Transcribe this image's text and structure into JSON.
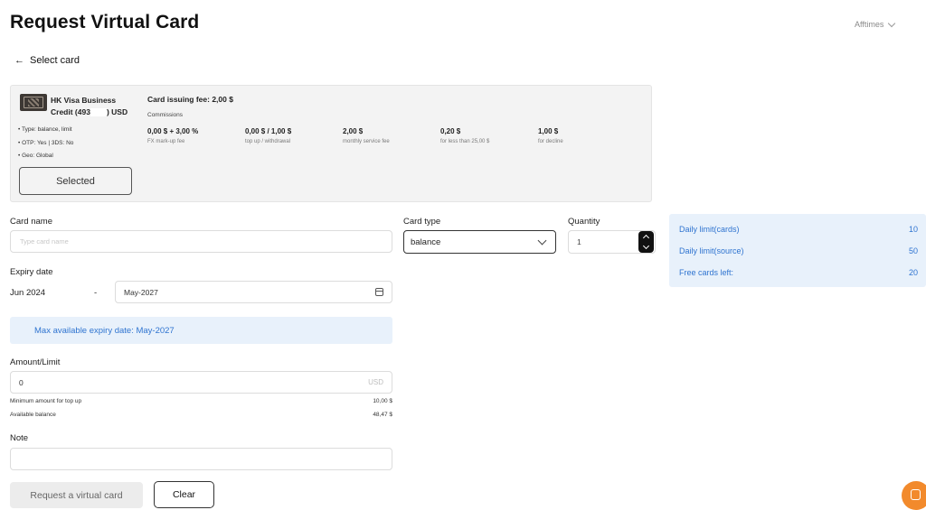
{
  "header": {
    "title": "Request Virtual Card",
    "user_name": "Afftimes",
    "back_label": "Select card",
    "back_arrow": "←"
  },
  "card": {
    "name_line1": "HK Visa Business",
    "name_line2_prefix": "Credit (493",
    "name_line2_suffix": ") USD",
    "specs": [
      "• Type: balance, limit",
      "• OTP: Yes | 3DS: No",
      "• Geo: Global"
    ],
    "issuing_fee": "Card issuing fee: 2,00 $",
    "commissions_label": "Commissions",
    "commissions": [
      {
        "value": "0,00 $ + 3,00 %",
        "label": "FX mark-up fee"
      },
      {
        "value": "0,00 $ / 1,00 $",
        "label": "top up / withdrawal"
      },
      {
        "value": "2,00 $",
        "label": "monthly service fee"
      },
      {
        "value": "0,20 $",
        "label": "for less than 25,00 $"
      },
      {
        "value": "1,00 $",
        "label": "for decline"
      }
    ],
    "selected_label": "Selected"
  },
  "form": {
    "card_name_label": "Card name",
    "card_name_placeholder": "Type card name",
    "card_type_label": "Card type",
    "card_type_value": "balance",
    "quantity_label": "Quantity",
    "quantity_value": "1",
    "expiry_label": "Expiry date",
    "expiry_from": "Jun 2024",
    "expiry_dash": "-",
    "expiry_to": "May-2027",
    "max_expiry_notice": "Max available expiry date: May-2027",
    "amount_label": "Amount/Limit",
    "amount_value": "0",
    "amount_currency": "USD",
    "min_amount_label": "Minimum amount  for top up",
    "min_amount_value": "10,00 $",
    "available_balance_label": "Available balance",
    "available_balance_value": "48,47 $",
    "note_label": "Note",
    "request_button": "Request a virtual card",
    "clear_button": "Clear"
  },
  "limits": [
    {
      "label": "Daily limit(cards)",
      "value": "10"
    },
    {
      "label": "Daily limit(source)",
      "value": "50"
    },
    {
      "label": "Free cards left:",
      "value": "20"
    }
  ],
  "colors": {
    "accent_blue": "#2f74d0",
    "info_bg": "#e8f1fb",
    "chat_orange": "#f28a2c"
  },
  "icons": [
    "back-arrow-icon",
    "chevron-down-icon",
    "calendar-icon",
    "stepper-up-icon",
    "stepper-down-icon",
    "chat-icon"
  ]
}
